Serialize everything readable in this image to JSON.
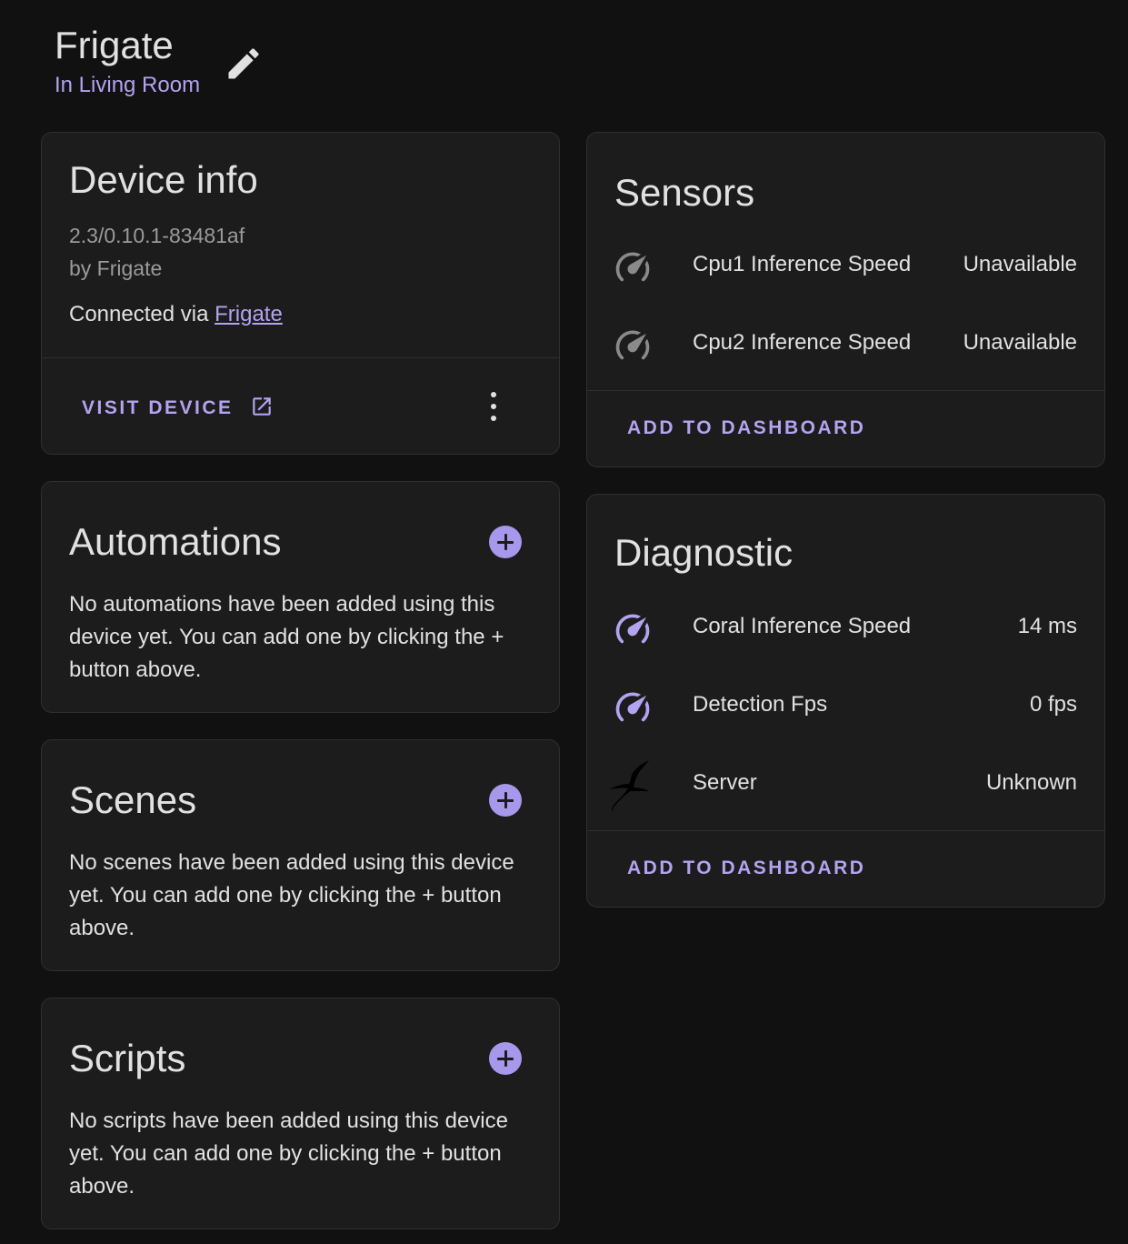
{
  "header": {
    "title": "Frigate",
    "subtitle": "In Living Room"
  },
  "device_info": {
    "heading": "Device info",
    "version": "2.3/0.10.1-83481af",
    "manufacturer": "by Frigate",
    "connected_prefix": "Connected via",
    "connected_link": "Frigate",
    "visit_label": "VISIT DEVICE"
  },
  "automations": {
    "heading": "Automations",
    "text": "No automations have been added using this device yet. You can add one by clicking the + button above."
  },
  "scenes": {
    "heading": "Scenes",
    "text": "No scenes have been added using this device yet. You can add one by clicking the + button above."
  },
  "scripts": {
    "heading": "Scripts",
    "text": "No scripts have been added using this device yet. You can add one by clicking the + button above."
  },
  "sensors": {
    "heading": "Sensors",
    "rows": [
      {
        "name": "Cpu1 Inference Speed",
        "value": "Unavailable",
        "icon": "speedometer-icon"
      },
      {
        "name": "Cpu2 Inference Speed",
        "value": "Unavailable",
        "icon": "speedometer-icon"
      }
    ],
    "action": "ADD TO DASHBOARD"
  },
  "diagnostic": {
    "heading": "Diagnostic",
    "rows": [
      {
        "name": "Coral Inference Speed",
        "value": "14 ms",
        "icon": "speedometer-icon"
      },
      {
        "name": "Detection Fps",
        "value": "0 fps",
        "icon": "speedometer-icon"
      },
      {
        "name": "Server",
        "value": "Unknown",
        "icon": "frigate-bird-icon"
      }
    ],
    "action": "ADD TO DASHBOARD"
  },
  "colors": {
    "accent": "#b3a3f0",
    "background": "#111111",
    "card": "#1c1c1c",
    "icon_unavailable": "#8a8a8a"
  }
}
